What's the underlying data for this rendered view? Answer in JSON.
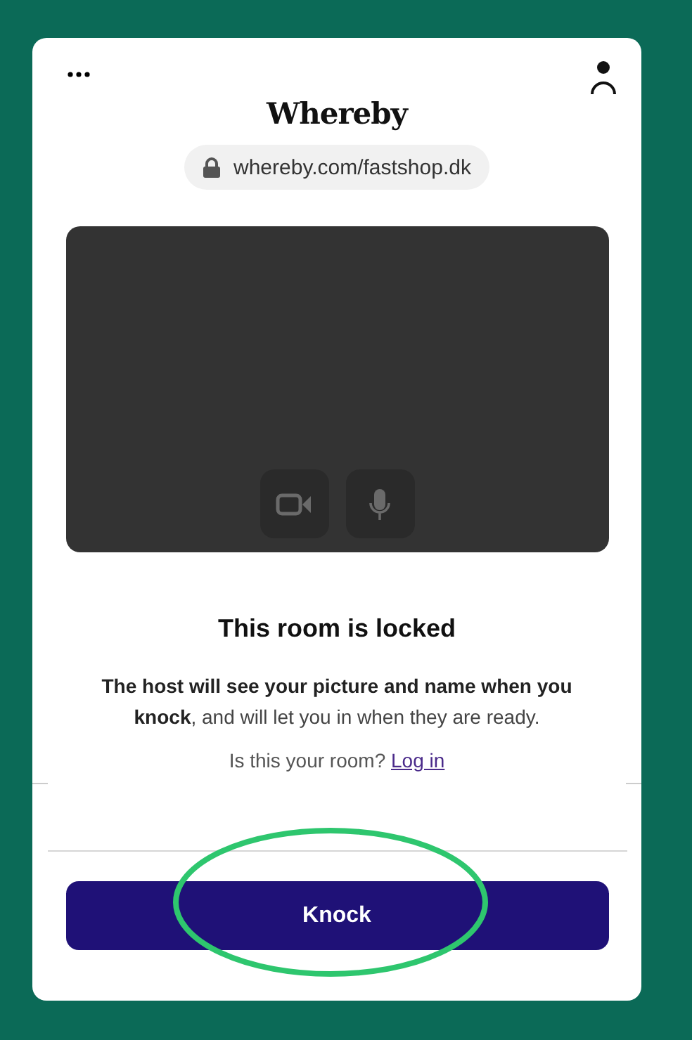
{
  "header": {
    "logo": "Whereby",
    "url": "whereby.com/fastshop.dk"
  },
  "room": {
    "title": "This room is locked",
    "message": "**The host will see your picture and name when you knock**, and will let you in when they are ready.",
    "prompt": "Is this your room?",
    "link": "Log in"
  },
  "knock_button": {
    "label": "Knock"
  }
}
